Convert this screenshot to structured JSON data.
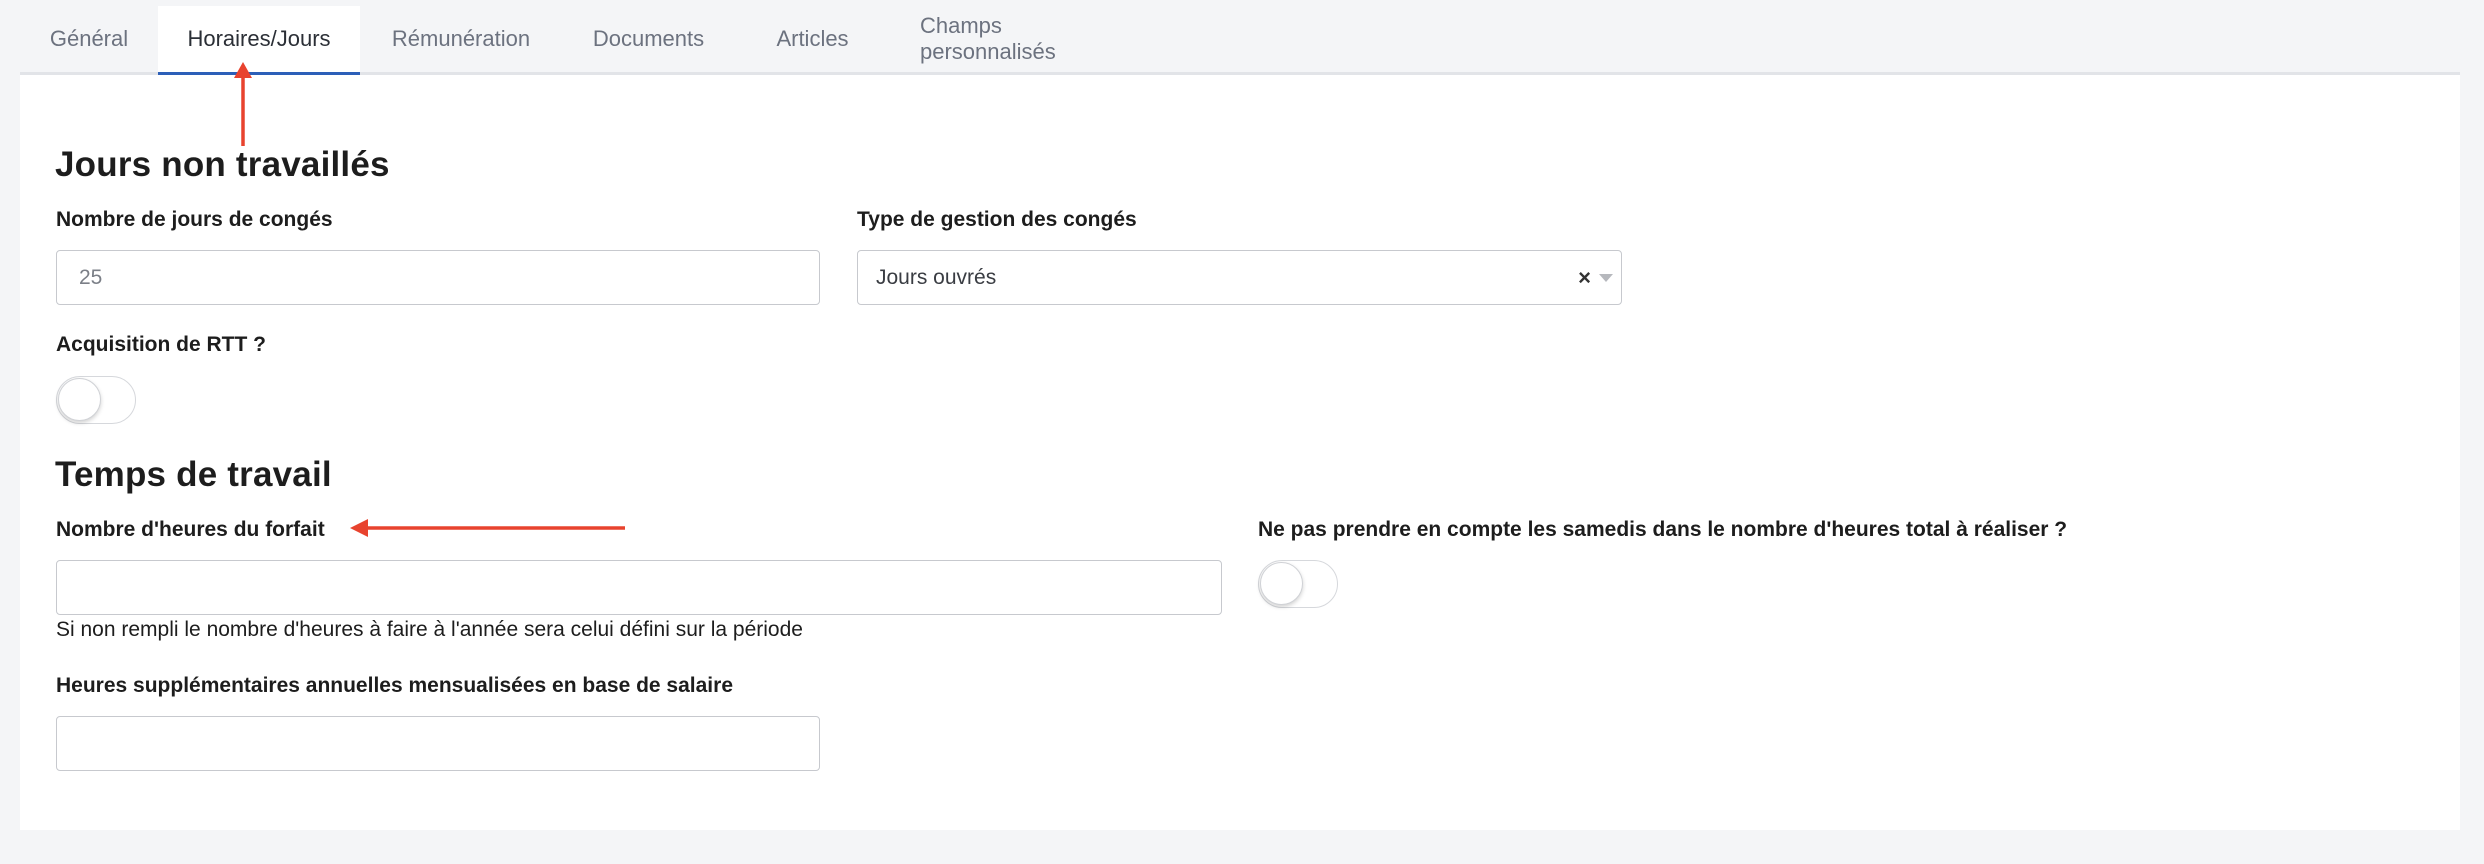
{
  "tabs": [
    {
      "label": "Général",
      "active": false
    },
    {
      "label": "Horaires/Jours",
      "active": true
    },
    {
      "label": "Rémunération",
      "active": false
    },
    {
      "label": "Documents",
      "active": false
    },
    {
      "label": "Articles",
      "active": false
    },
    {
      "label": "Champs personnalisés",
      "active": false
    }
  ],
  "sections": {
    "non_worked": {
      "title": "Jours non travaillés",
      "leave_days": {
        "label": "Nombre de jours de congés",
        "value": "25"
      },
      "leave_type": {
        "label": "Type de gestion des congés",
        "value": "Jours ouvrés",
        "clear_symbol": "×"
      },
      "rtt": {
        "label": "Acquisition de RTT ?",
        "enabled": false
      }
    },
    "work_time": {
      "title": "Temps de travail",
      "forfait_hours": {
        "label": "Nombre d'heures du forfait",
        "value": "",
        "help": "Si non rempli le nombre d'heures à faire à l'année sera celui défini sur la période"
      },
      "ignore_saturdays": {
        "label": "Ne pas prendre en compte les samedis dans le nombre d'heures total à réaliser ?",
        "enabled": false
      },
      "overtime": {
        "label": "Heures supplémentaires annuelles mensualisées en base de salaire",
        "value": ""
      }
    }
  },
  "colors": {
    "annotation_arrow": "#e8432e",
    "active_tab_underline": "#2c5fb8"
  }
}
